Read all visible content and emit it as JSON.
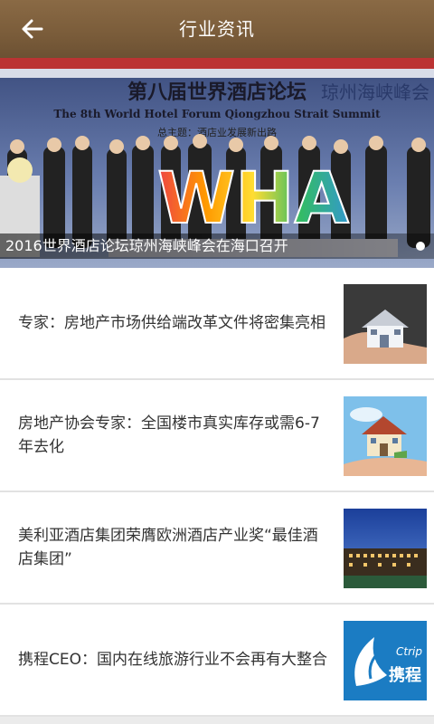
{
  "header": {
    "title": "行业资讯",
    "back_icon": "back-arrow-icon"
  },
  "banner": {
    "caption": "2016世界酒店论坛琼州海峡峰会在海口召开",
    "backdrop_title_cn": "第八届世界酒店论坛",
    "backdrop_title_cn_sub": "琼州海峡峰会",
    "backdrop_title_en": "The 8th World Hotel Forum Qiongzhou Strait Summit",
    "backdrop_theme": "总主题：酒店业发展新出路",
    "sculpture_text": "WHA",
    "active_slide": 1,
    "slide_count": 1
  },
  "news": [
    {
      "title": "专家：房地产市场供给端改革文件将密集亮相",
      "thumb": "house-in-hands"
    },
    {
      "title": "房地产协会专家：全国楼市真实库存或需6-7年去化",
      "thumb": "house-on-hand-sky"
    },
    {
      "title": "美利亚酒店集团荣膺欧洲酒店产业奖“最佳酒店集团”",
      "thumb": "hotel-night"
    },
    {
      "title": "携程CEO：国内在线旅游行业不会再有大整合",
      "thumb": "ctrip-logo",
      "logo_text_en": "Ctrip",
      "logo_text_cn": "携程"
    }
  ]
}
